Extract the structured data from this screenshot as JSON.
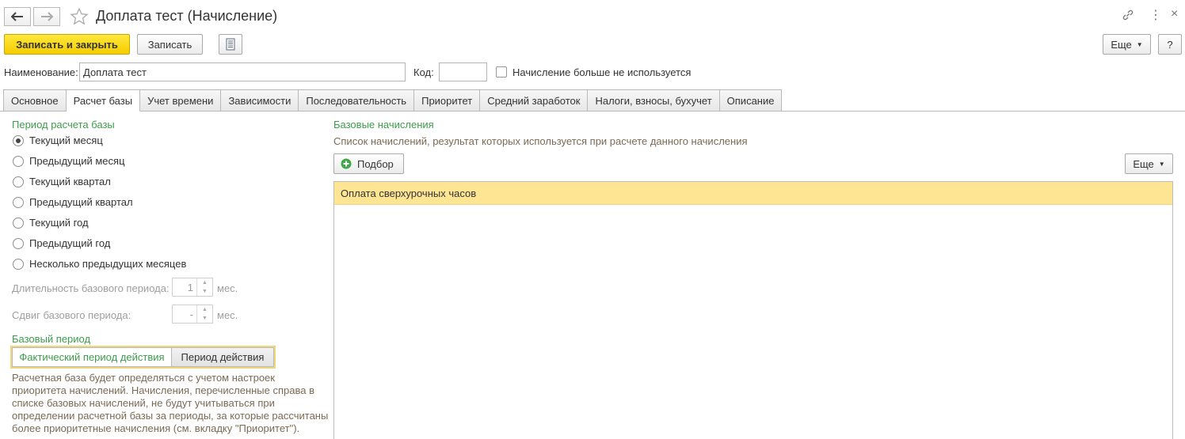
{
  "window": {
    "title": "Доплата тест (Начисление)"
  },
  "toolbar": {
    "save_close_label": "Записать и закрыть",
    "save_label": "Записать",
    "more_label": "Еще",
    "help_label": "?"
  },
  "header_fields": {
    "name_label": "Наименование:",
    "name_value": "Доплата тест",
    "code_label": "Код:",
    "code_value": "",
    "not_used_label": "Начисление больше не используется"
  },
  "tabs": [
    {
      "label": "Основное"
    },
    {
      "label": "Расчет базы"
    },
    {
      "label": "Учет времени"
    },
    {
      "label": "Зависимости"
    },
    {
      "label": "Последовательность"
    },
    {
      "label": "Приоритет"
    },
    {
      "label": "Средний заработок"
    },
    {
      "label": "Налоги, взносы, бухучет"
    },
    {
      "label": "Описание"
    }
  ],
  "base_period": {
    "section_title": "Период расчета базы",
    "options": [
      {
        "label": "Текущий месяц",
        "selected": true
      },
      {
        "label": "Предыдущий месяц",
        "selected": false
      },
      {
        "label": "Текущий квартал",
        "selected": false
      },
      {
        "label": "Предыдущий квартал",
        "selected": false
      },
      {
        "label": "Текущий год",
        "selected": false
      },
      {
        "label": "Предыдущий год",
        "selected": false
      },
      {
        "label": "Несколько предыдущих месяцев",
        "selected": false
      }
    ],
    "duration_label": "Длительность базового периода:",
    "duration_value": "1",
    "duration_unit": "мес.",
    "shift_label": "Сдвиг базового периода:",
    "shift_value": "-",
    "shift_unit": "мес."
  },
  "base_period_type": {
    "section_title": "Базовый период",
    "option_actual": "Фактический период действия",
    "option_period": "Период действия",
    "hint": "Расчетная база будет определяться с учетом настроек приоритета начислений. Начисления, перечисленные справа в списке базовых начислений, не будут учитываться при определении расчетной базы за периоды, за которые рассчитаны более приоритетные начисления (см. вкладку \"Приоритет\")."
  },
  "base_accruals": {
    "section_title": "Базовые начисления",
    "description": "Список начислений, результат которых используется при расчете данного начисления",
    "pick_label": "Подбор",
    "more_label": "Еще",
    "rows": [
      {
        "name": "Оплата сверхурочных часов"
      }
    ]
  },
  "colors": {
    "accent_green": "#3d9c4b",
    "primary_yellow": "#f5cd00",
    "selected_row": "#fde594"
  }
}
